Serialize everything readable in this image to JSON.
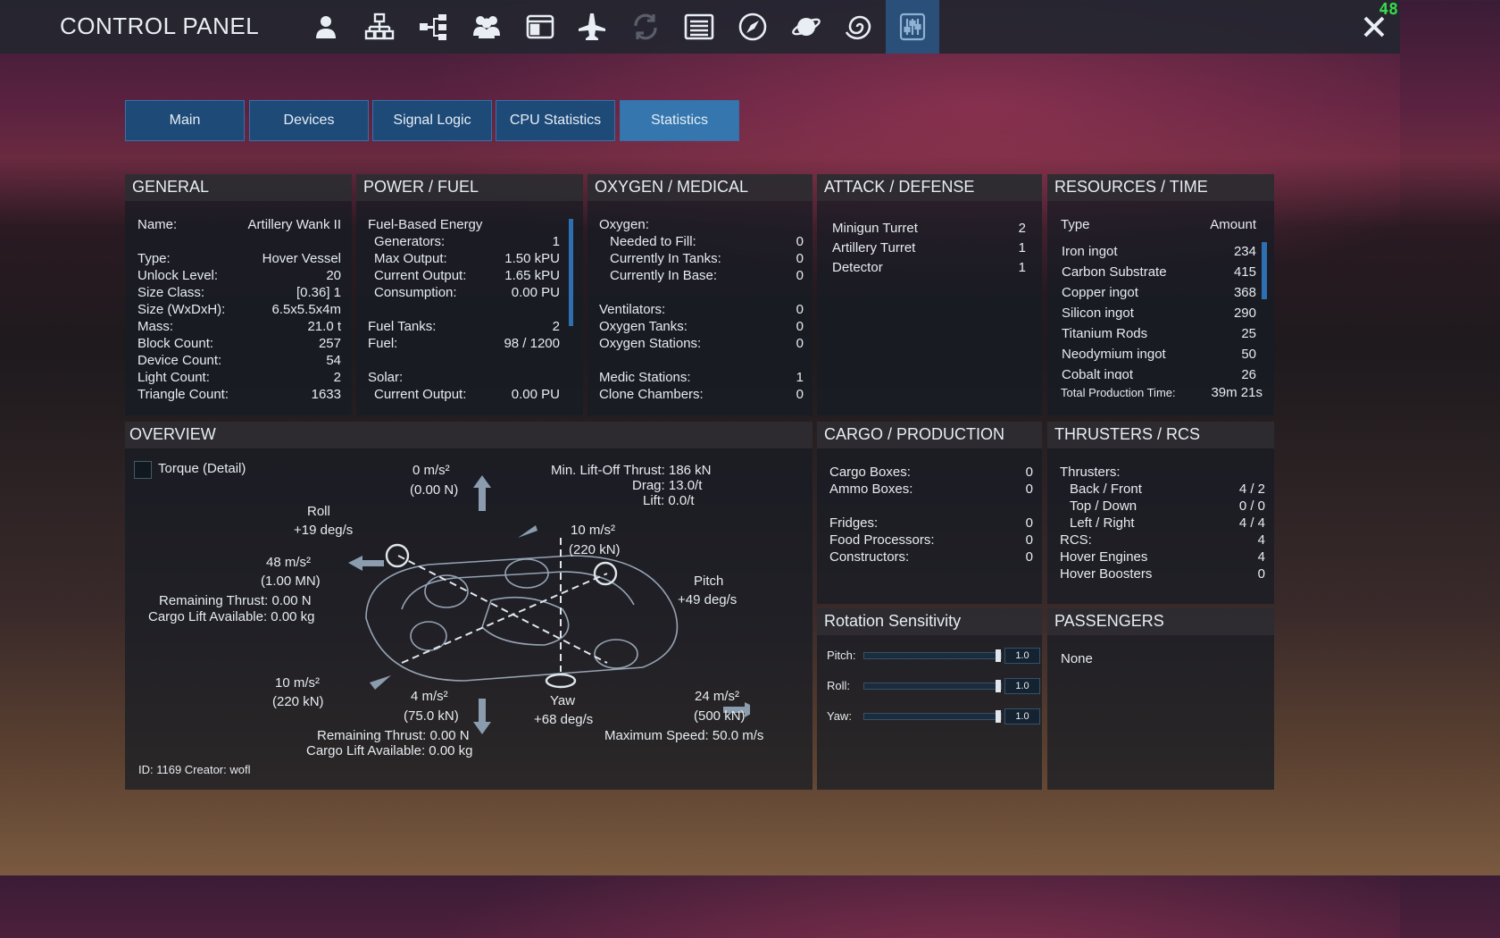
{
  "app": {
    "title": "CONTROL PANEL",
    "fps": "48"
  },
  "toolbar": {
    "icons": [
      "person-icon",
      "structure-icon",
      "hierarchy-icon",
      "group-icon",
      "window-icon",
      "ship-icon",
      "sync-icon",
      "list-icon",
      "compass-icon",
      "planet-icon",
      "galaxy-icon",
      "settings-sliders-icon"
    ],
    "active": "settings-sliders-icon"
  },
  "tabs": [
    {
      "label": "Main"
    },
    {
      "label": "Devices"
    },
    {
      "label": "Signal Logic"
    },
    {
      "label": "CPU Statistics"
    },
    {
      "label": "Statistics"
    }
  ],
  "active_tab": "Statistics",
  "general": {
    "title": "GENERAL",
    "rows": [
      {
        "label": "Name:",
        "value": "Artillery Wank II"
      },
      {
        "label": "Type:",
        "value": "Hover Vessel"
      },
      {
        "label": "Unlock Level:",
        "value": "20"
      },
      {
        "label": "Size Class:",
        "value": "[0.36]   1"
      },
      {
        "label": "Size (WxDxH):",
        "value": "6.5x5.5x4m"
      },
      {
        "label": "Mass:",
        "value": "21.0 t"
      },
      {
        "label": "Block Count:",
        "value": "257"
      },
      {
        "label": "Device Count:",
        "value": "54"
      },
      {
        "label": "Light Count:",
        "value": "2"
      },
      {
        "label": "Triangle Count:",
        "value": "1633"
      }
    ]
  },
  "power": {
    "title": "POWER / FUEL",
    "fuel_energy": "Fuel-Based Energy",
    "generators_label": "Generators:",
    "generators": "1",
    "max_output_label": "Max Output:",
    "max_output": "1.50 kPU",
    "current_output_label": "Current Output:",
    "current_output": "1.65 kPU",
    "consumption_label": "Consumption:",
    "consumption": "0.00 PU",
    "fuel_tanks_label": "Fuel Tanks:",
    "fuel_tanks": "2",
    "fuel_label": "Fuel:",
    "fuel": "98 / 1200",
    "solar": "Solar:",
    "solar_output_label": "Current Output:",
    "solar_output": "0.00 PU"
  },
  "oxygen": {
    "title": "OXYGEN / MEDICAL",
    "oxygen": "Oxygen:",
    "needed_label": "Needed to Fill:",
    "needed": "0",
    "in_tanks_label": "Currently In Tanks:",
    "in_tanks": "0",
    "in_base_label": "Currently In Base:",
    "in_base": "0",
    "ventilators_label": "Ventilators:",
    "ventilators": "0",
    "oxygen_tanks_label": "Oxygen Tanks:",
    "oxygen_tanks": "0",
    "oxygen_stations_label": "Oxygen Stations:",
    "oxygen_stations": "0",
    "medic_label": "Medic Stations:",
    "medic": "1",
    "clone_label": "Clone Chambers:",
    "clone": "0"
  },
  "attack": {
    "title": "ATTACK / DEFENSE",
    "rows": [
      {
        "label": "Minigun Turret",
        "value": "2"
      },
      {
        "label": "Artillery Turret",
        "value": "1"
      },
      {
        "label": "Detector",
        "value": "1"
      }
    ]
  },
  "resources": {
    "title": "RESOURCES / TIME",
    "type_header": "Type",
    "amount_header": "Amount",
    "rows": [
      {
        "label": "Iron ingot",
        "value": "234"
      },
      {
        "label": "Carbon Substrate",
        "value": "415"
      },
      {
        "label": "Copper ingot",
        "value": "368"
      },
      {
        "label": "Silicon ingot",
        "value": "290"
      },
      {
        "label": "Titanium Rods",
        "value": "25"
      },
      {
        "label": "Neodymium ingot",
        "value": "50"
      },
      {
        "label": "Cobalt ingot",
        "value": "26"
      }
    ],
    "total_label": "Total Production Time:",
    "total_value": "39m 21s"
  },
  "overview": {
    "title": "OVERVIEW",
    "torque_label": "Torque (Detail)",
    "up_accel": "0 m/s²",
    "up_force": "(0.00 N)",
    "liftoff": "Min. Lift-Off Thrust: 186 kN",
    "drag": "Drag: 13.0/t",
    "lift": "Lift: 0.0/t",
    "roll_label": "Roll",
    "roll_rate": "+19 deg/s",
    "fwd_accel": "10 m/s²",
    "fwd_force": "(220 kN)",
    "left_accel": "48 m/s²",
    "left_force": "(1.00 MN)",
    "pitch_label": "Pitch",
    "pitch_rate": "+49 deg/s",
    "remaining1": "Remaining Thrust: 0.00 N",
    "cargo1": "Cargo Lift Available: 0.00 kg",
    "back_accel": "10 m/s²",
    "back_force": "(220 kN)",
    "down_accel": "4 m/s²",
    "down_force": "(75.0 kN)",
    "yaw_label": "Yaw",
    "yaw_rate": "+68 deg/s",
    "right_accel": "24 m/s²",
    "right_force": "(500 kN)",
    "remaining2": "Remaining Thrust: 0.00 N",
    "cargo2": "Cargo Lift Available: 0.00 kg",
    "max_speed": "Maximum Speed: 50.0 m/s",
    "id_creator": "ID: 1169  Creator: wofl"
  },
  "cargo": {
    "title": "CARGO / PRODUCTION",
    "rows": [
      {
        "label": "Cargo Boxes:",
        "value": "0"
      },
      {
        "label": "Ammo Boxes:",
        "value": "0"
      },
      {
        "label": "Fridges:",
        "value": "0"
      },
      {
        "label": "Food Processors:",
        "value": "0"
      },
      {
        "label": "Constructors:",
        "value": "0"
      }
    ]
  },
  "thrusters": {
    "title": "THRUSTERS / RCS",
    "thrusters_label": "Thrusters:",
    "rows": [
      {
        "label": "Back / Front",
        "value": "4 / 2"
      },
      {
        "label": "Top / Down",
        "value": "0 / 0"
      },
      {
        "label": "Left / Right",
        "value": "4 / 4"
      }
    ],
    "rcs_label": "RCS:",
    "rcs": "4",
    "hover_engines_label": "Hover Engines",
    "hover_engines": "4",
    "hover_boosters_label": "Hover Boosters",
    "hover_boosters": "0"
  },
  "rotation": {
    "title": "Rotation Sensitivity",
    "sliders": [
      {
        "label": "Pitch:",
        "value": "1.0",
        "fraction": 1.0
      },
      {
        "label": "Roll:",
        "value": "1.0",
        "fraction": 1.0
      },
      {
        "label": "Yaw:",
        "value": "1.0",
        "fraction": 1.0
      }
    ]
  },
  "passengers": {
    "title": "PASSENGERS",
    "value": "None"
  },
  "colors": {
    "accent": "#3476ad",
    "tab": "#1e4a78",
    "fps": "#3ad84a",
    "panel_header": "#302e32"
  }
}
